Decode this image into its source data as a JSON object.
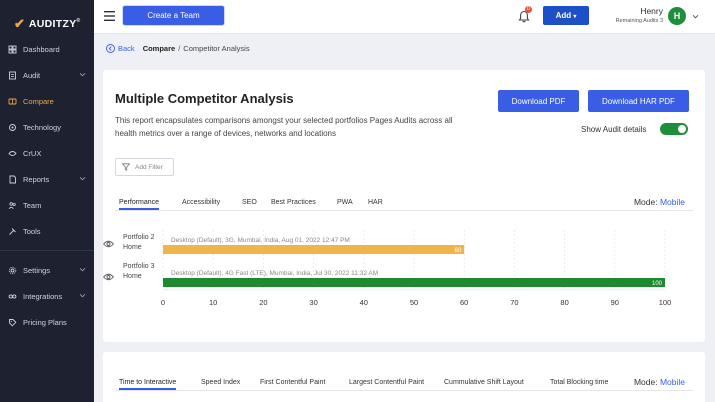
{
  "brand": {
    "name": "AUDITZY",
    "reg": "®"
  },
  "sidebar": {
    "items": [
      {
        "label": "Dashboard",
        "icon": "dashboard-icon",
        "chevron": false
      },
      {
        "label": "Audit",
        "icon": "audit-icon",
        "chevron": true
      },
      {
        "label": "Compare",
        "icon": "compare-icon",
        "chevron": false,
        "active": true
      },
      {
        "label": "Technology",
        "icon": "technology-icon",
        "chevron": false
      },
      {
        "label": "CrUX",
        "icon": "crux-icon",
        "chevron": false
      },
      {
        "label": "Reports",
        "icon": "reports-icon",
        "chevron": true
      },
      {
        "label": "Team",
        "icon": "team-icon",
        "chevron": false
      },
      {
        "label": "Tools",
        "icon": "tools-icon",
        "chevron": false
      },
      {
        "label": "Settings",
        "icon": "settings-icon",
        "chevron": true
      },
      {
        "label": "Integrations",
        "icon": "integrations-icon",
        "chevron": true
      },
      {
        "label": "Pricing Plans",
        "icon": "pricing-icon",
        "chevron": false
      }
    ]
  },
  "topbar": {
    "create_team": "Create a Team",
    "notification_count": "0",
    "add_label": "Add",
    "user_name": "Henry",
    "user_sub": "Remaining Audits 3",
    "avatar_initial": "H"
  },
  "breadcrumb": {
    "back": "Back",
    "compare": "Compare",
    "separator": "/",
    "current": "Competitor Analysis"
  },
  "page": {
    "title": "Multiple Competitor Analysis",
    "description": "This report encapsulates comparisons amongst your selected portfolios Pages Audits across all health metrics over a range of devices, networks and locations",
    "download_pdf": "Download PDF",
    "download_har_pdf": "Download HAR PDF",
    "show_audit_details": "Show Audit details",
    "show_audit_details_on": true,
    "filter_placeholder": "Add Filter"
  },
  "tabs": [
    {
      "label": "Performance",
      "active": true
    },
    {
      "label": "Accessibility"
    },
    {
      "label": "SEO"
    },
    {
      "label": "Best Practices"
    },
    {
      "label": "PWA"
    },
    {
      "label": "HAR"
    }
  ],
  "mode": {
    "label": "Mode:",
    "value": "Mobile"
  },
  "chart_data": {
    "type": "bar",
    "orientation": "horizontal",
    "categories": [
      "Portfolio 2 Home",
      "Portfolio 3 Home"
    ],
    "rows": [
      {
        "portfolio": "Portfolio 2",
        "page": "Home",
        "config": "Desktop (Default), 3G, Mumbai, India, Aug 01, 2022 12:47 PM",
        "value": 60,
        "color": "#f0b54a"
      },
      {
        "portfolio": "Portfolio 3",
        "page": "Home",
        "config": "Desktop (Default), 4G Fast (LTE), Mumbai, India, Jul 30, 2022 11:32 AM",
        "value": 100,
        "color": "#1d8a2f"
      }
    ],
    "xlim": [
      0,
      100
    ],
    "xticks": [
      0,
      10,
      20,
      30,
      40,
      50,
      60,
      70,
      80,
      90,
      100
    ],
    "grid": true
  },
  "tabs2": [
    {
      "label": "Time to Interactive",
      "active": true
    },
    {
      "label": "Speed Index"
    },
    {
      "label": "First Contentful Paint"
    },
    {
      "label": "Largest Contentful Paint"
    },
    {
      "label": "Cummulative Shift Layout"
    },
    {
      "label": "Total Blocking time"
    }
  ],
  "mode2": {
    "label": "Mode:",
    "value": "Mobile"
  },
  "colors": {
    "accent": "#3a5de5",
    "sidebar": "#1e2230",
    "active_nav": "#f2a541",
    "success": "#1d8f3a"
  }
}
